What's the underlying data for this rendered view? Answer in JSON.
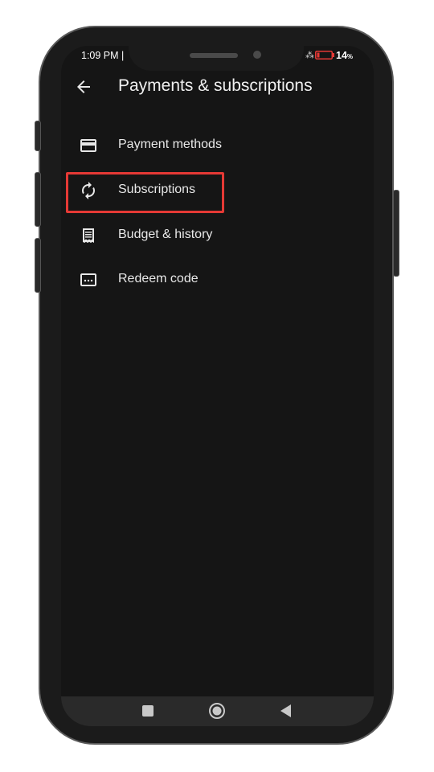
{
  "status_bar": {
    "time": "1:09 PM |",
    "battery_pct": "14",
    "battery_unit": "%",
    "battery_color": "#e53935"
  },
  "header": {
    "title": "Payments & subscriptions",
    "back_icon": "arrow-left-icon"
  },
  "menu": {
    "items": [
      {
        "label": "Payment methods",
        "icon": "credit-card-icon"
      },
      {
        "label": "Subscriptions",
        "icon": "refresh-icon",
        "highlighted": true
      },
      {
        "label": "Budget & history",
        "icon": "receipt-icon"
      },
      {
        "label": "Redeem code",
        "icon": "redeem-code-icon"
      }
    ]
  },
  "highlight_color": "#e53935",
  "nav_bar": {
    "icons": [
      "recents-square-icon",
      "home-circle-icon",
      "back-triangle-icon"
    ]
  }
}
